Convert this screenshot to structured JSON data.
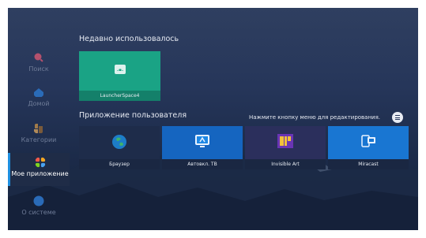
{
  "sidebar": {
    "items": [
      {
        "label": "Поиск",
        "icon": "search-icon",
        "active": false
      },
      {
        "label": "Домой",
        "icon": "home-icon",
        "active": false
      },
      {
        "label": "Категории",
        "icon": "categories-icon",
        "active": false
      },
      {
        "label": "Мое приложение",
        "icon": "my-apps-icon",
        "active": true
      },
      {
        "label": "О системе",
        "icon": "info-icon",
        "active": false
      }
    ]
  },
  "recent": {
    "title": "Недавно использовалось",
    "apps": [
      {
        "label": "LauncherSpace4",
        "icon": "android-icon",
        "color": "#1aa385"
      }
    ]
  },
  "user_apps": {
    "title": "Приложение пользователя",
    "hint": "Нажмите кнопку меню для редактирования.",
    "menu_icon": "menu-icon",
    "apps": [
      {
        "label": "Браузер",
        "icon": "globe-icon",
        "color": "#1e2c4a"
      },
      {
        "label": "Автовкл. ТВ",
        "icon": "tv-autostart-icon",
        "color": "#1565c0"
      },
      {
        "label": "Invisible Art",
        "icon": "invisible-art-icon",
        "color": "#2b2f5c"
      },
      {
        "label": "Miracast",
        "icon": "miracast-icon",
        "color": "#1976d2"
      }
    ]
  },
  "colors": {
    "accent": "#1e8fe0",
    "background": "#26365a"
  }
}
